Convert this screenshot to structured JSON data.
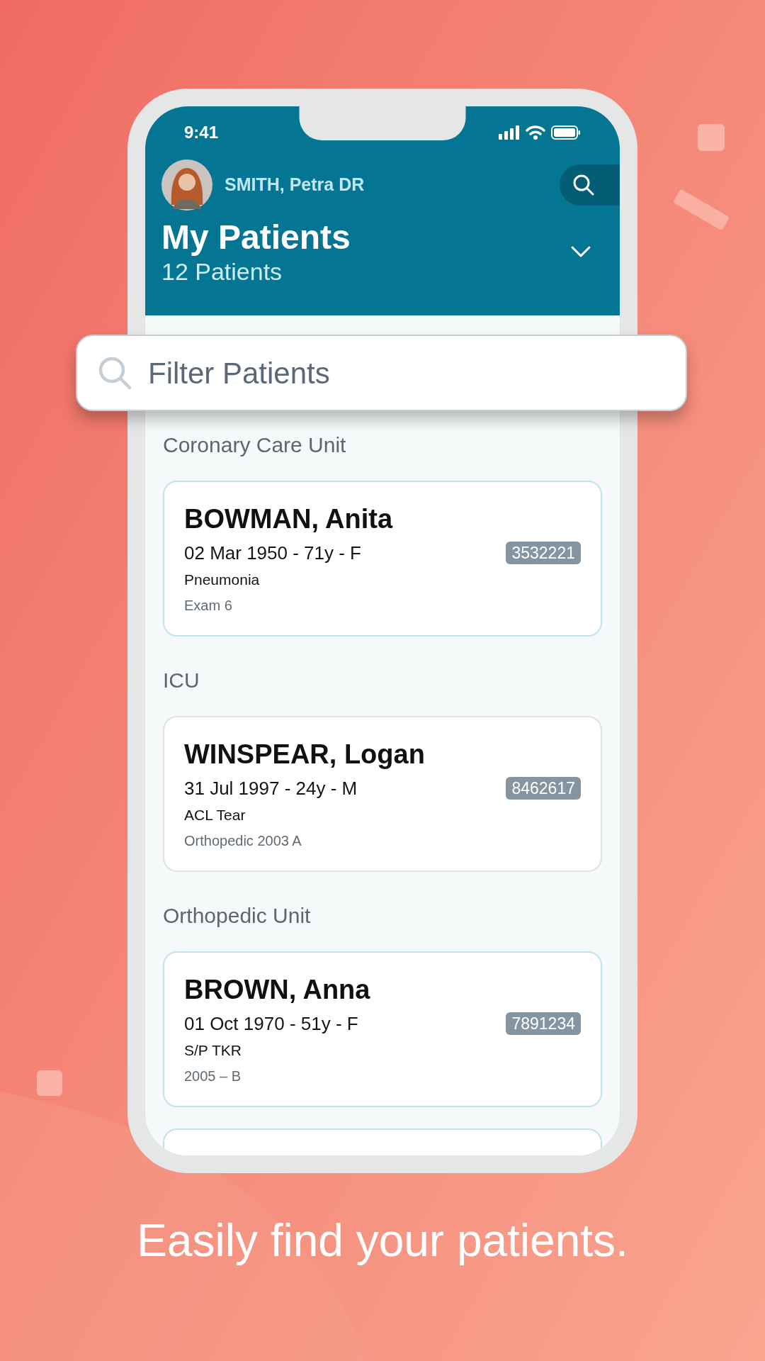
{
  "status_bar": {
    "time": "9:41"
  },
  "header": {
    "user_name": "SMITH, Petra DR",
    "title": "My Patients",
    "subtitle": "12 Patients"
  },
  "filter": {
    "placeholder": "Filter Patients"
  },
  "sections": [
    {
      "title": "Coronary Care Unit",
      "patients": [
        {
          "name": "BOWMAN, Anita",
          "details": "02 Mar 1950 - 71y - F",
          "mrn": "3532221",
          "diagnosis": "Pneumonia",
          "location": "Exam 6",
          "color": "#bfe3ec"
        }
      ]
    },
    {
      "title": "ICU",
      "patients": [
        {
          "name": "WINSPEAR, Logan",
          "details": "31 Jul 1997 - 24y - M",
          "mrn": "8462617",
          "diagnosis": "ACL Tear",
          "location": "Orthopedic 2003 A",
          "color": "#dde3e6"
        }
      ]
    },
    {
      "title": "Orthopedic Unit",
      "patients": [
        {
          "name": "BROWN, Anna",
          "details": "01 Oct 1970 - 51y - F",
          "mrn": "7891234",
          "diagnosis": "S/P TKR",
          "location": "2005 – B",
          "color": "#bfe3ec"
        }
      ]
    }
  ],
  "more_below": true,
  "caption": "Easily find your patients."
}
